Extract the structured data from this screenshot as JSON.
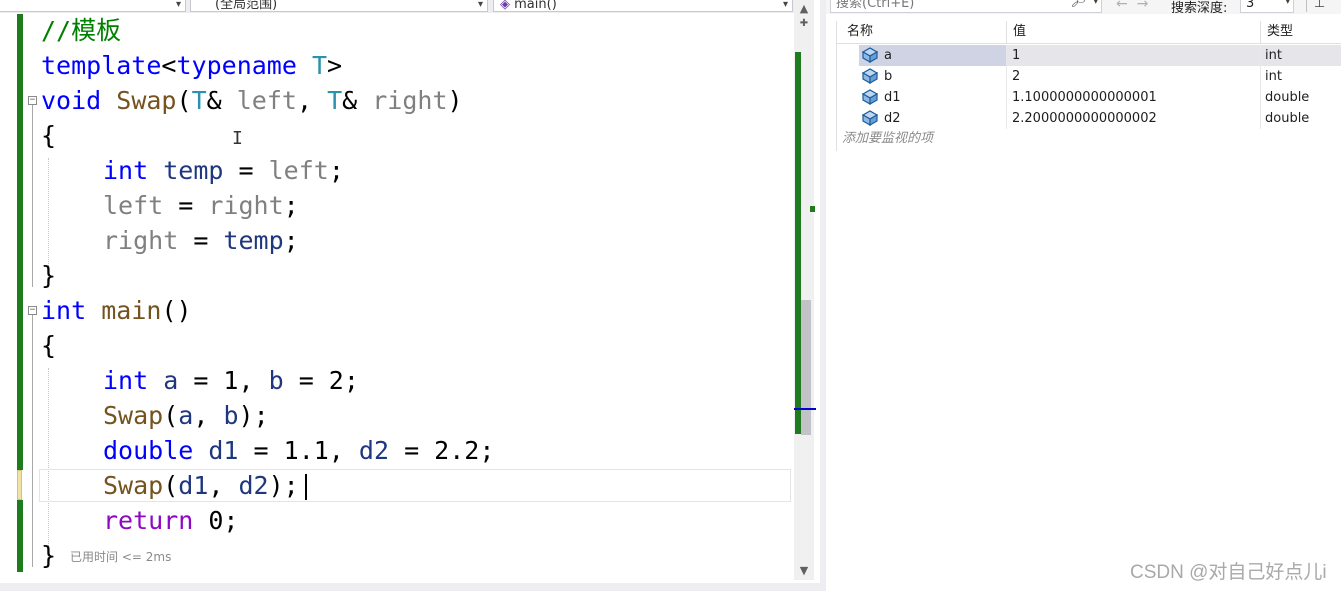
{
  "editor": {
    "scope_dropdown": "(全局范围)",
    "function_dropdown": "main()",
    "code_lines": {
      "l1": "//模板",
      "l2_kw": "template",
      "l2_rest_a": "<",
      "l2_kw2": "typename",
      "l2_sp": " ",
      "l2_tp": "T",
      "l2_end": ">",
      "l3_kw": "void",
      "l3_fn": "Swap",
      "l3_p1": "(",
      "l3_t1": "T",
      "l3_amp1": "& ",
      "l3_left": "left",
      "l3_comma": ", ",
      "l3_t2": "T",
      "l3_amp2": "& ",
      "l3_right": "right",
      "l3_close": ")",
      "l4": "{",
      "l5_kw": "int",
      "l5_var": "temp",
      "l5_eq": " = ",
      "l5_left": "left",
      "l5_semi": ";",
      "l6_left": "left",
      "l6_eq": " = ",
      "l6_right": "right",
      "l6_semi": ";",
      "l7_right": "right",
      "l7_eq": " = ",
      "l7_temp": "temp",
      "l7_semi": ";",
      "l8": "}",
      "l9_kw": "int",
      "l9_fn": "main",
      "l9_rest": "()",
      "l10": "{",
      "l11_kw": "int",
      "l11_a": "a",
      "l11_mid": " = 1, ",
      "l11_b": "b",
      "l11_end": " = 2;",
      "l12_fn": "Swap",
      "l12_open": "(",
      "l12_a": "a",
      "l12_comma": ", ",
      "l12_b": "b",
      "l12_end": ");",
      "l13_kw": "double",
      "l13_d1": "d1",
      "l13_mid": " = 1.1, ",
      "l13_d2": "d2",
      "l13_end": " = 2.2;",
      "l14_fn": "Swap",
      "l14_open": "(",
      "l14_d1": "d1",
      "l14_comma": ", ",
      "l14_d2": "d2",
      "l14_end": ");",
      "l15_kw": "return",
      "l15_rest": " 0;",
      "l16": "}"
    },
    "elapsed_hint": "已用时间 <= 2ms"
  },
  "watch": {
    "search_placeholder": "搜索(Ctrl+E)",
    "search_depth_label": "搜索深度:",
    "search_depth_value": "3",
    "columns": {
      "name": "名称",
      "value": "值",
      "type": "类型"
    },
    "rows": [
      {
        "name": "a",
        "value": "1",
        "type": "int"
      },
      {
        "name": "b",
        "value": "2",
        "type": "int"
      },
      {
        "name": "d1",
        "value": "1.1000000000000001",
        "type": "double"
      },
      {
        "name": "d2",
        "value": "2.2000000000000002",
        "type": "double"
      }
    ],
    "add_watch_hint": "添加要监视的项"
  },
  "watermark": "CSDN @对自己好点儿i",
  "colors": {
    "accent_green": "#1e7b1e",
    "keyword_blue": "#0000ff",
    "selection": "#cfd3e4"
  }
}
